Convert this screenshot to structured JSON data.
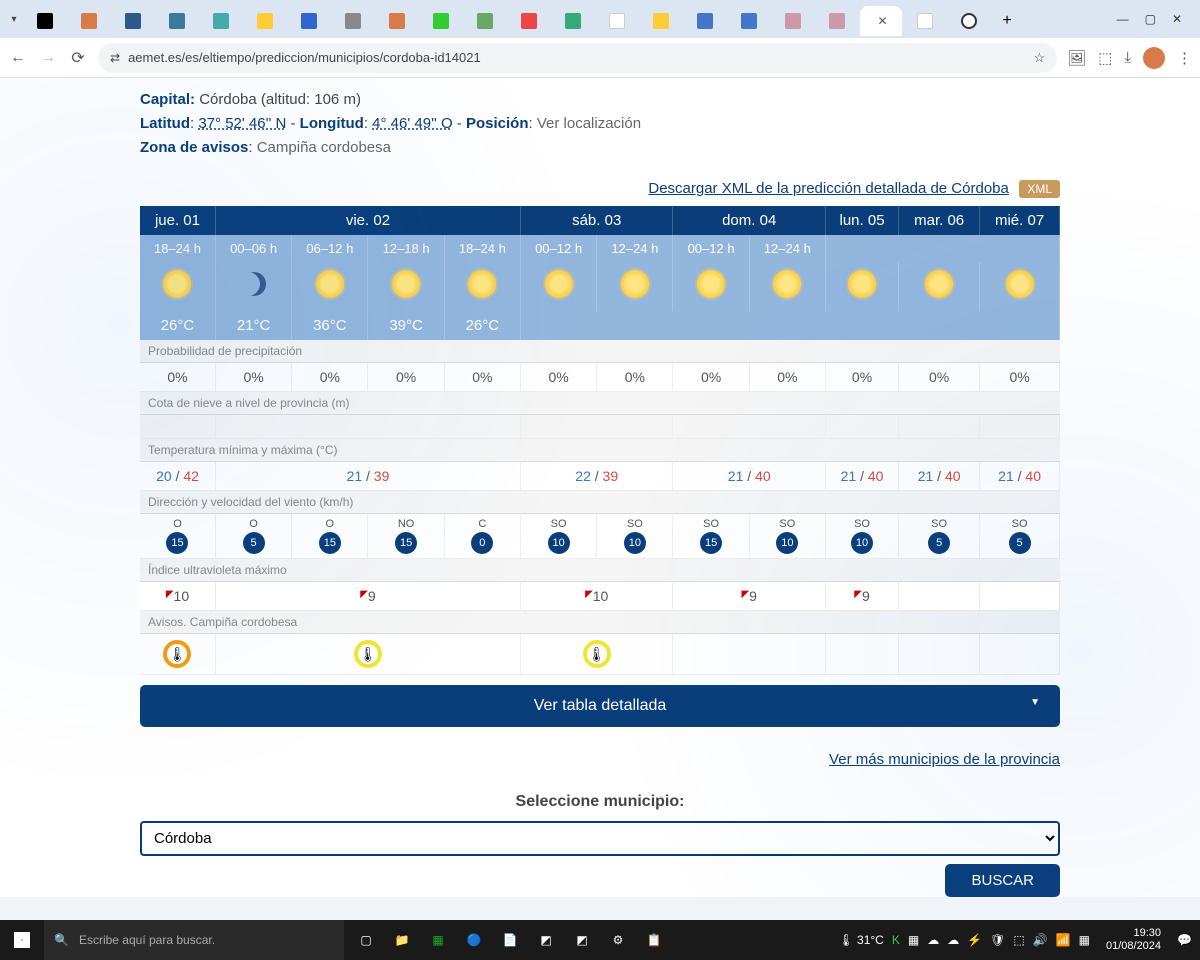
{
  "browser": {
    "url": "aemet.es/es/eltiempo/prediccion/municipios/cordoba-id14021"
  },
  "geo": {
    "capital_label": "Capital:",
    "capital_value": "Córdoba (altitud: 106 m)",
    "lat_label": "Latitud",
    "lat_value": "37° 52' 46'' N",
    "lon_label": "Longitud",
    "lon_value": "4° 46' 49'' O",
    "pos_label": "Posición",
    "pos_link": "Ver localización",
    "zone_label": "Zona de avisos",
    "zone_value": "Campiña cordobesa"
  },
  "xml": {
    "text": "Descargar XML de la predicción detallada de Córdoba",
    "badge": "XML"
  },
  "days": [
    "jue. 01",
    "vie. 02",
    "sáb. 03",
    "dom. 04",
    "lun. 05",
    "mar. 06",
    "mié. 07"
  ],
  "hours": [
    "18–24 h",
    "00–06 h",
    "06–12 h",
    "12–18 h",
    "18–24 h",
    "00–12 h",
    "12–24 h",
    "00–12 h",
    "12–24 h"
  ],
  "temps_row": [
    "26°C",
    "21°C",
    "36°C",
    "39°C",
    "26°C",
    "",
    "",
    "",
    ""
  ],
  "labels": {
    "precip": "Probabilidad de precipitación",
    "snow": "Cota de nieve a nivel de provincia (m)",
    "minmax": "Temperatura mínima y máxima (°C)",
    "wind": "Dirección y velocidad del viento (km/h)",
    "uv": "Índice ultravioleta máximo",
    "warn": "Avisos. Campiña cordobesa"
  },
  "precip": [
    "0%",
    "0%",
    "0%",
    "0%",
    "0%",
    "0%",
    "0%",
    "0%",
    "0%",
    "0%",
    "0%",
    "0%"
  ],
  "minmax": [
    {
      "min": "20",
      "max": "42"
    },
    {
      "min": "21",
      "max": "39"
    },
    {
      "min": "22",
      "max": "39"
    },
    {
      "min": "21",
      "max": "40"
    },
    {
      "min": "21",
      "max": "40"
    },
    {
      "min": "21",
      "max": "40"
    },
    {
      "min": "21",
      "max": "40"
    }
  ],
  "wind": [
    {
      "dir": "O",
      "spd": "15"
    },
    {
      "dir": "O",
      "spd": "5"
    },
    {
      "dir": "O",
      "spd": "15"
    },
    {
      "dir": "NO",
      "spd": "15"
    },
    {
      "dir": "C",
      "spd": "0"
    },
    {
      "dir": "SO",
      "spd": "10"
    },
    {
      "dir": "SO",
      "spd": "10"
    },
    {
      "dir": "SO",
      "spd": "15"
    },
    {
      "dir": "SO",
      "spd": "10"
    },
    {
      "dir": "SO",
      "spd": "10"
    },
    {
      "dir": "SO",
      "spd": "5"
    },
    {
      "dir": "SO",
      "spd": "5"
    }
  ],
  "uv": [
    "10",
    "9",
    "10",
    "9",
    "9",
    "",
    ""
  ],
  "detail_btn": "Ver tabla detallada",
  "more_link": "Ver más municipios de la provincia",
  "select_label": "Seleccione municipio:",
  "select_value": "Córdoba",
  "search_btn": "BUSCAR",
  "taskbar": {
    "search_placeholder": "Escribe aquí para buscar.",
    "temp": "31°C",
    "time": "19:30",
    "date": "01/08/2024"
  }
}
